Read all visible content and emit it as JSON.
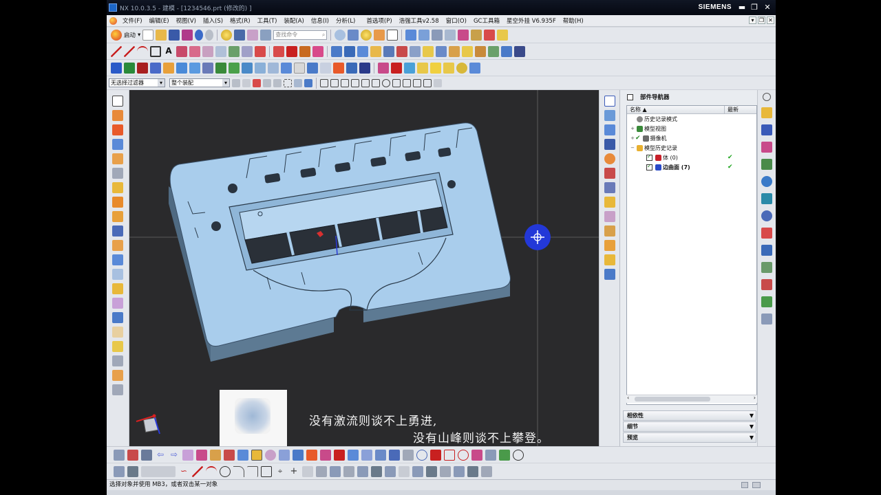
{
  "window": {
    "title": "NX 10.0.3.5 - 建模 - [1234546.prt  (修改的) ]",
    "brand": "SIEMENS",
    "minimize": "▬",
    "restore": "❐",
    "close": "✕"
  },
  "menubar": {
    "items": [
      "文件(F)",
      "编辑(E)",
      "视图(V)",
      "插入(S)",
      "格式(R)",
      "工具(T)",
      "装配(A)",
      "信息(I)",
      "分析(L)",
      "首选项(P)",
      "浩强工具v2.58",
      "窗口(O)",
      "GC工具箱",
      "星空外挂 V6.935F",
      "帮助(H)"
    ],
    "right_buttons": [
      "▾",
      "❐",
      "✕"
    ]
  },
  "toolbar1": {
    "start_label": "启动",
    "search_placeholder": "查找命令"
  },
  "selection_bar": {
    "filter_value": "无选择过滤器",
    "scope_value": "整个装配"
  },
  "navigator": {
    "title": "部件导航器",
    "col_name": "名称",
    "col_latest": "最新",
    "rows": [
      {
        "label": "历史记录模式",
        "indent": 0,
        "expander": "",
        "icon_color": "#888888"
      },
      {
        "label": "模型视图",
        "indent": 0,
        "expander": "+",
        "icon_color": "#3a8a3a"
      },
      {
        "label": "摄像机",
        "indent": 0,
        "expander": "+",
        "icon_color": "#2a8a2a"
      },
      {
        "label": "模型历史记录",
        "indent": 0,
        "expander": "−",
        "icon_color": "#e8b030"
      },
      {
        "label": "体 (0)",
        "indent": 1,
        "expander": "",
        "icon_color": "#c8202a",
        "latest": "✔"
      },
      {
        "label": "边曲面 (7)",
        "indent": 1,
        "expander": "",
        "icon_color": "#2a4ac8",
        "latest": "✔"
      }
    ],
    "sections": [
      "相依性",
      "细节",
      "预览"
    ]
  },
  "subtitles": {
    "line1": "没有激流则谈不上勇进,",
    "line2": "没有山峰则谈不上攀登。"
  },
  "status": {
    "prompt": "选择对象并使用 MB3，或者双击某一对象"
  },
  "colors": {
    "viewport_bg": "#2a2a2c",
    "part_face": "#a9cdec",
    "part_side": "#5d7a93",
    "accent_blue": "#2338d8"
  }
}
